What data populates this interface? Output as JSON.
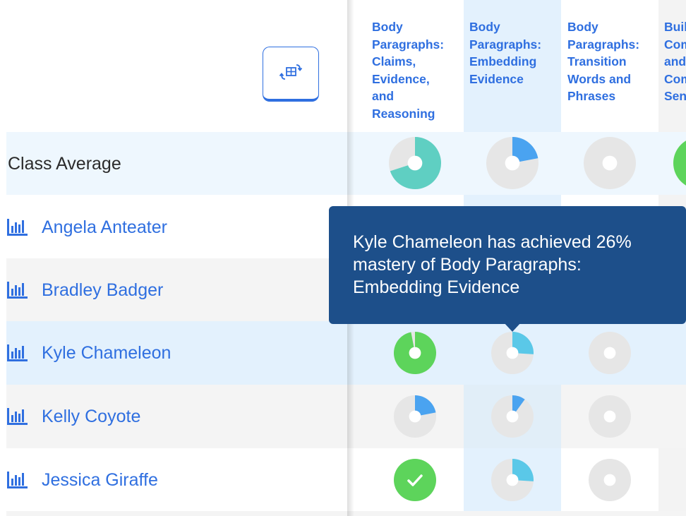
{
  "columns": [
    {
      "title": "Body\nParagraphs:\nClaims,\nEvidence,\nand\nReasoning"
    },
    {
      "title": "Body\nParagraphs:\nEmbedding\nEvidence"
    },
    {
      "title": "Body\nParagraphs:\nTransition\nWords and\nPhrases"
    },
    {
      "title": "Building\nCompound\nand\nComplex\nSentences"
    }
  ],
  "class_average_label": "Class Average",
  "students": [
    {
      "name": "Angela Anteater"
    },
    {
      "name": "Bradley Badger"
    },
    {
      "name": "Kyle Chameleon"
    },
    {
      "name": "Kelly Coyote"
    },
    {
      "name": "Jessica Giraffe"
    }
  ],
  "mastery": {
    "class_average": [
      0.7,
      0.22,
      0.0,
      null
    ],
    "Kyle Chameleon": [
      0.97,
      0.26,
      0.0,
      null
    ],
    "Kelly Coyote": [
      0.22,
      0.1,
      0.0,
      null
    ],
    "Jessica Giraffe": [
      1.0,
      0.26,
      0.0,
      null
    ]
  },
  "tooltip": {
    "text": "Kyle Chameleon has achieved 26% mastery of Body Paragraphs: Embedding Evidence"
  },
  "colors": {
    "accent": "#2f6fe0",
    "teal": "#5fcfc2",
    "green": "#5dd45b",
    "blue_slice": "#4aa3f0",
    "cyan_slice": "#5ac8e8",
    "empty": "#e6e6e6",
    "tooltip_bg": "#1d4f8a"
  },
  "icons": {
    "pivot": "swap-rows-columns-icon",
    "student_report": "bar-chart-icon",
    "complete": "checkmark-icon"
  }
}
